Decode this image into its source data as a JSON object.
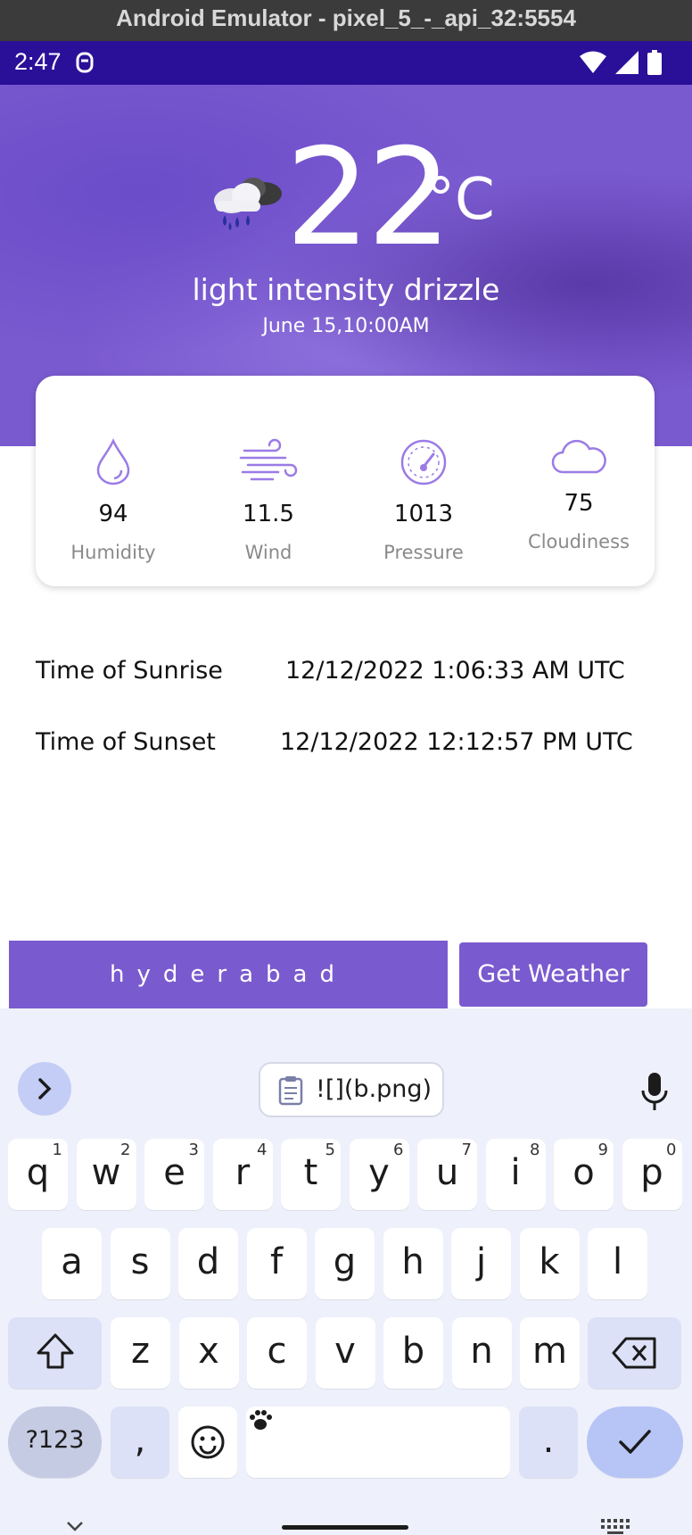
{
  "window": {
    "title": "Android Emulator - pixel_5_-_api_32:5554"
  },
  "status_bar": {
    "time": "2:47"
  },
  "weather": {
    "icon": "rain-cloud-icon",
    "temperature": "22",
    "unit": "°C",
    "description": "light intensity drizzle",
    "datetime": "June 15,10:00AM"
  },
  "stats": [
    {
      "value": "94",
      "label": "Humidity",
      "icon": "droplet-icon"
    },
    {
      "value": "11.5",
      "label": "Wind",
      "icon": "wind-icon"
    },
    {
      "value": "1013",
      "label": "Pressure",
      "icon": "gauge-icon"
    },
    {
      "value": "75",
      "label": "Cloudiness",
      "icon": "cloud-icon"
    }
  ],
  "sun": {
    "sunrise_label": "Time of Sunrise",
    "sunrise_value": "12/12/2022 1:06:33 AM UTC",
    "sunset_label": "Time of Sunset",
    "sunset_value": "12/12/2022 12:12:57 PM UTC"
  },
  "search": {
    "city_value": "hyderabad",
    "button_label": "Get Weather"
  },
  "keyboard": {
    "clipboard_text": "![](b.png)",
    "row1": [
      [
        "q",
        "1"
      ],
      [
        "w",
        "2"
      ],
      [
        "e",
        "3"
      ],
      [
        "r",
        "4"
      ],
      [
        "t",
        "5"
      ],
      [
        "y",
        "6"
      ],
      [
        "u",
        "7"
      ],
      [
        "i",
        "8"
      ],
      [
        "o",
        "9"
      ],
      [
        "p",
        "0"
      ]
    ],
    "row2": [
      "a",
      "s",
      "d",
      "f",
      "g",
      "h",
      "j",
      "k",
      "l"
    ],
    "row3": [
      "z",
      "x",
      "c",
      "v",
      "b",
      "n",
      "m"
    ],
    "symbols_label": "?123",
    "comma": ",",
    "period": "."
  },
  "colors": {
    "accent": "#7a5acf",
    "status_bar": "#2a1098",
    "keyboard_bg": "#eef0fb"
  }
}
